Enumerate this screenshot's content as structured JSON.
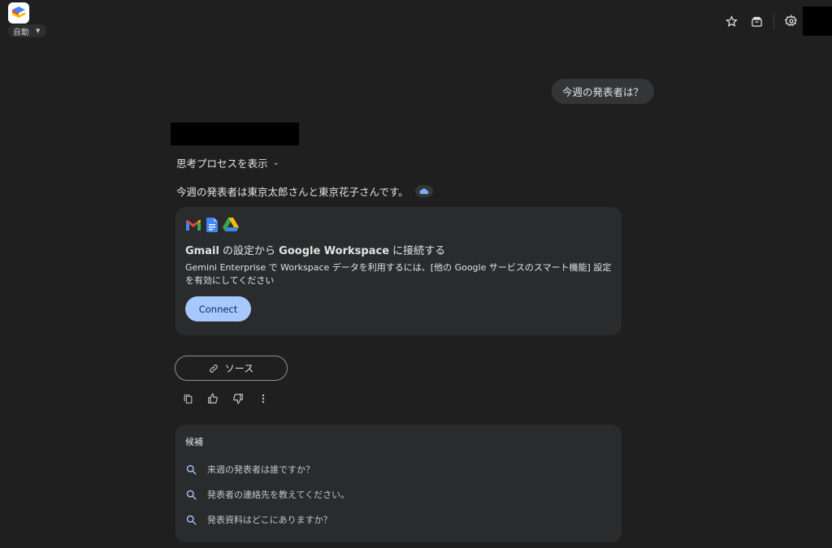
{
  "header": {
    "mode_label": "自動",
    "icons": [
      "star-icon",
      "archive-icon",
      "settings-icon"
    ]
  },
  "conversation": {
    "user_message": "今週の発表者は？",
    "thinking_toggle": "思考プロセスを表示",
    "answer": "今週の発表者は東京太郎さんと東京花子さんです。"
  },
  "connect_card": {
    "title_gmail": "Gmail",
    "title_mid": " の設定から ",
    "title_workspace": "Google Workspace",
    "title_end": " に接続する",
    "description": "Gemini Enterprise で Workspace データを利用するには、[他の Google サービスのスマート機能] 設定を有効にしてください",
    "button_label": "Connect"
  },
  "sources": {
    "label": "ソース"
  },
  "suggestions": {
    "label": "候補",
    "items": [
      "来週の発表者は誰ですか？",
      "発表者の連絡先を教えてください。",
      "発表資料はどこにありますか？"
    ]
  },
  "colors": {
    "background": "#1f1f1f",
    "card": "#2a2b2d",
    "accent_button": "#a8c7fa"
  }
}
